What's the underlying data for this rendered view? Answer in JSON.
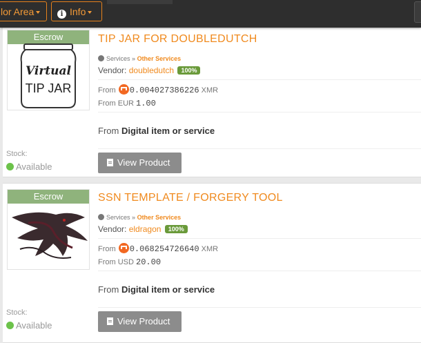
{
  "navbar": {
    "vendor_area_label": "lor Area",
    "info_label": "Info"
  },
  "listings": [
    {
      "escrow": "Escrow",
      "title": "TIP JAR FOR DOUBLEDUTCH",
      "category_parent": "Services",
      "category_sep": "»",
      "category": "Other Services",
      "vendor_label": "Vendor:",
      "vendor": "doubledutch",
      "rating": "100%",
      "from_label": "From",
      "xmr_price": "0.004027386226",
      "xmr_unit": "XMR",
      "fiat_currency": "EUR",
      "fiat_price": "1.00",
      "ship_from_label": "From",
      "ship_from": "Digital item or service",
      "stock_label": "Stock:",
      "stock_value": "Available",
      "button": "View Product",
      "thumbnail_text_line1": "Virtual",
      "thumbnail_text_line2": "TIP JAR"
    },
    {
      "escrow": "Escrow",
      "title": "SSN TEMPLATE / FORGERY TOOL",
      "category_parent": "Services",
      "category_sep": "»",
      "category": "Other Services",
      "vendor_label": "Vendor:",
      "vendor": "eldragon",
      "rating": "100%",
      "from_label": "From",
      "xmr_price": "0.068254726640",
      "xmr_unit": "XMR",
      "fiat_currency": "USD",
      "fiat_price": "20.00",
      "ship_from_label": "From",
      "ship_from": "Digital item or service",
      "stock_label": "Stock:",
      "stock_value": "Available",
      "button": "View Product"
    }
  ],
  "colors": {
    "accent": "#f08a1e",
    "escrow": "#8fb37c",
    "badge": "#6a9a3a",
    "navbar": "#2e2e2e"
  }
}
